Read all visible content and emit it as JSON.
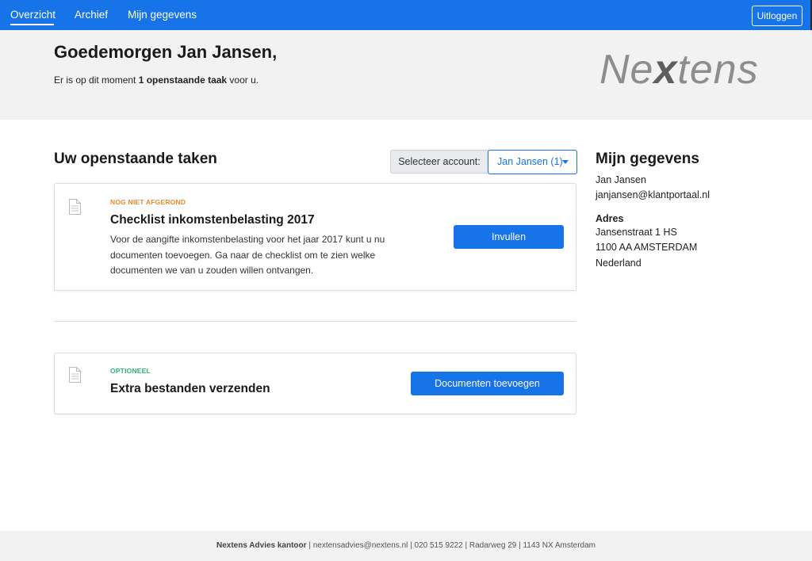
{
  "nav": {
    "items": [
      {
        "label": "Overzicht",
        "active": true
      },
      {
        "label": "Archief",
        "active": false
      },
      {
        "label": "Mijn gegevens",
        "active": false
      }
    ],
    "logout_label": "Uitloggen"
  },
  "hero": {
    "greeting": "Goedemorgen Jan Jansen,",
    "subline_prefix": "Er is op dit moment ",
    "subline_bold": "1 openstaande taak",
    "subline_suffix": " voor u.",
    "logo_part1": "Ne",
    "logo_x": "x",
    "logo_part2": "tens"
  },
  "tasks": {
    "title": "Uw openstaande taken",
    "select_label": "Selecteer account:",
    "select_value": "Jan Jansen (1)",
    "items": [
      {
        "tag": "NOG NIET AFGEROND",
        "tag_color": "#e8892b",
        "title": "Checklist inkomstenbelasting 2017",
        "description": "Voor de aangifte inkomstenbelasting voor het jaar 2017 kunt u nu documenten toevoegen. Ga naar de checklist om te zien welke documenten we van u zouden willen ontvangen.",
        "button": "Invullen"
      },
      {
        "tag": "OPTIONEEL",
        "tag_color": "#2bb673",
        "title": "Extra bestanden verzenden",
        "button": "Documenten toevoegen"
      }
    ]
  },
  "profile": {
    "title": "Mijn gegevens",
    "name": "Jan Jansen",
    "email": "janjansen@klantportaal.nl",
    "address_label": "Adres",
    "street": "Jansenstraat 1 HS",
    "city": "1100 AA  AMSTERDAM",
    "country": "Nederland"
  },
  "footer": {
    "company": "Nextens Advies kantoor",
    "details": " | nextensadvies@nextens.nl | 020 515 9222 | Radarweg 29 | 1143 NX Amsterdam"
  },
  "colors": {
    "brand_blue": "#1673e8",
    "hero_bg": "#f2f2f2",
    "tag_orange": "#e8892b",
    "tag_green": "#2bb673"
  }
}
